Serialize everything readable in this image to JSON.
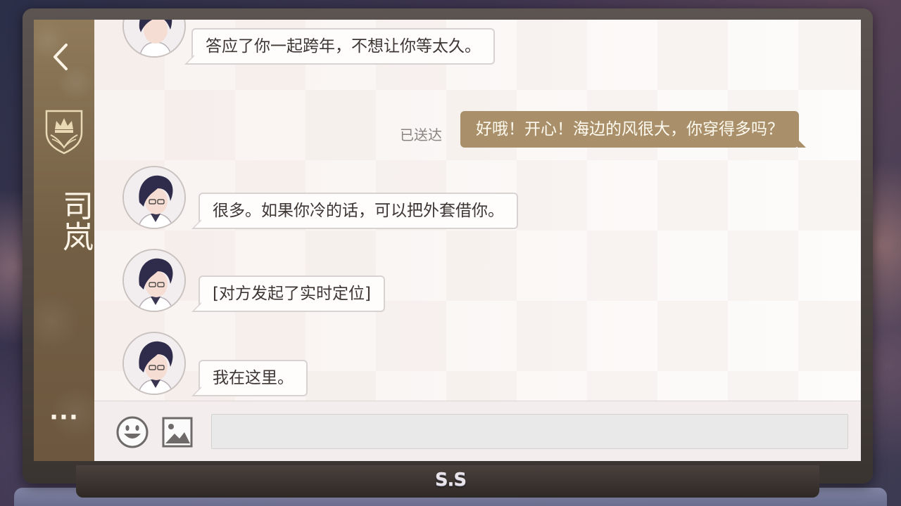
{
  "app": {
    "brand_logo": "S.S"
  },
  "sidebar": {
    "back_icon": "chevron-left-icon",
    "crest_icon": "crown-crest-icon",
    "contact_name": "司岚",
    "more_label": "···"
  },
  "messages": [
    {
      "from": "contact",
      "text": "答应了你一起跨年，不想让你等太久。"
    },
    {
      "from": "me",
      "text": "好哦！开心！海边的风很大，你穿得多吗？",
      "status": "已送达"
    },
    {
      "from": "contact",
      "text": "很多。如果你冷的话，可以把外套借你。"
    },
    {
      "from": "contact",
      "text": "[对方发起了实时定位]"
    },
    {
      "from": "contact",
      "text": "我在这里。"
    }
  ],
  "input_bar": {
    "emoji_icon": "smiley-icon",
    "image_icon": "image-icon",
    "input_value": "",
    "input_placeholder": ""
  },
  "colors": {
    "sidebar": "#7e6a4d",
    "outgoing_bubble": "#a9906a",
    "device_frame": "#4a413d"
  }
}
